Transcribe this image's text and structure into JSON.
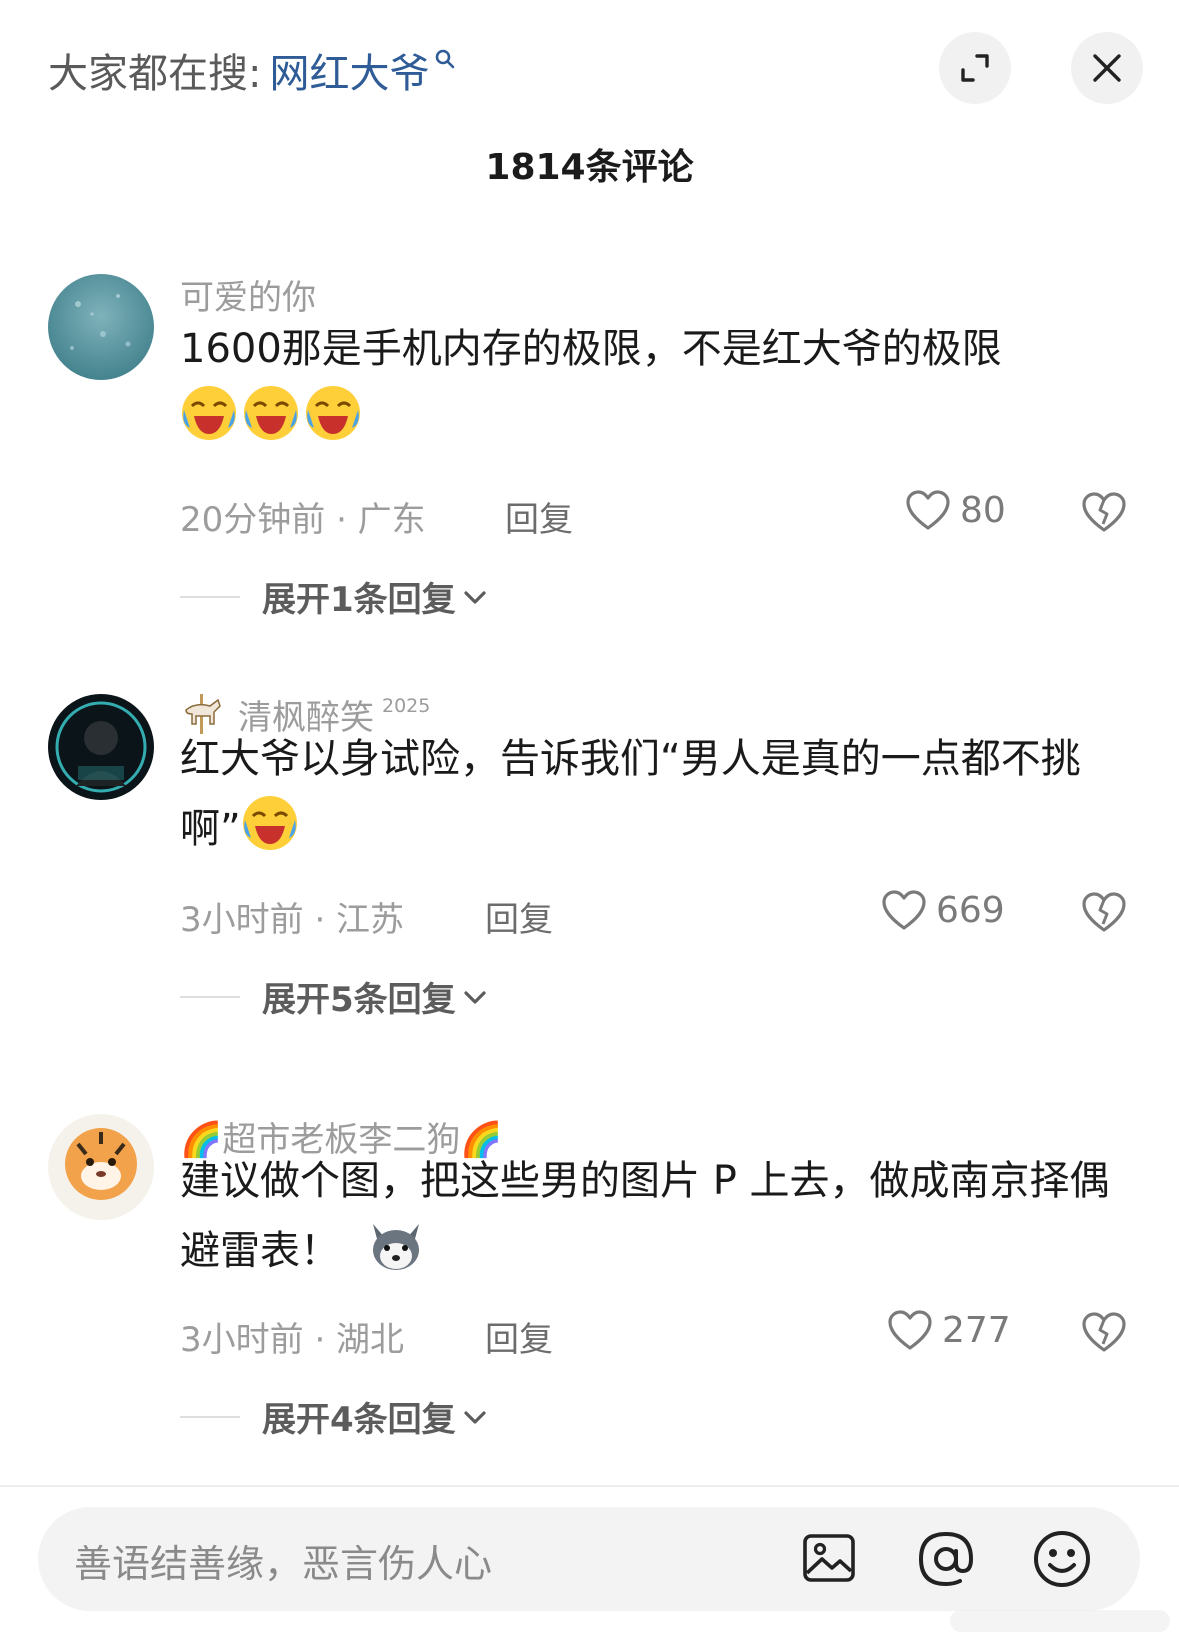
{
  "header": {
    "search_prefix": "大家都在搜:",
    "search_term": "网红大爷"
  },
  "comment_count_label": "1814条评论",
  "comments": [
    {
      "username": "可爱的你",
      "text": "1600那是手机内存的极限，不是红大爷的极限",
      "emoji_count": 3,
      "meta": "20分钟前 · 广东",
      "reply_label": "回复",
      "likes": "80",
      "expand_label": "展开1条回复"
    },
    {
      "username": "清枫醉笑",
      "badge_year": "2025",
      "text": "红大爷以身试险，告诉我们“男人是真的一点都不挑啊”",
      "emoji_count": 1,
      "meta": "3小时前 · 江苏",
      "reply_label": "回复",
      "likes": "669",
      "expand_label": "展开5条回复"
    },
    {
      "username": "🌈超市老板李二狗🌈",
      "text": "建议做个图，把这些男的图片 P 上去，做成南京择偶避雷表！",
      "emoji_count": 1,
      "meta": "3小时前 · 湖北",
      "reply_label": "回复",
      "likes": "277",
      "expand_label": "展开4条回复"
    }
  ],
  "input": {
    "placeholder": "善语结善缘，恶言伤人心"
  },
  "icons": {
    "expand": "expand-icon",
    "close": "close-icon",
    "like": "heart-outline-icon",
    "dislike": "broken-heart-icon",
    "image": "image-icon",
    "at": "at-icon",
    "emoji": "smiley-icon"
  },
  "colors": {
    "search_term": "#2f5b96",
    "meta_text": "#9c9c9c"
  }
}
